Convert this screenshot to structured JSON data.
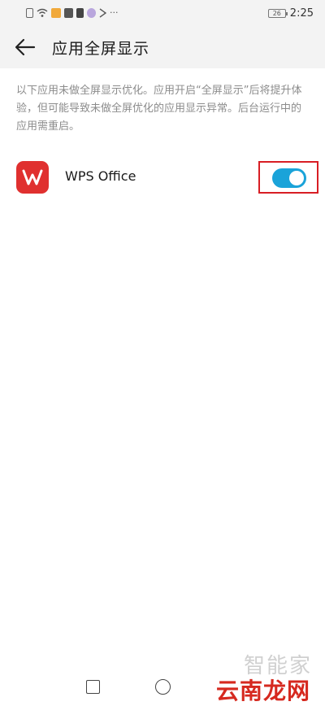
{
  "status_bar": {
    "time": "2:25",
    "battery_level": "26",
    "more_indicator": "···"
  },
  "header": {
    "title": "应用全屏显示"
  },
  "description": "以下应用未做全屏显示优化。应用开启“全屏显示”后将提升体验，但可能导致未做全屏优化的应用显示异常。后台运行中的应用需重启。",
  "apps": [
    {
      "name": "WPS Office",
      "icon": "wps-office-icon",
      "fullscreen_enabled": true
    }
  ],
  "watermark": {
    "top_text": "智能家",
    "bottom_text": "云南龙网"
  },
  "colors": {
    "toggle_on": "#1aa3d9",
    "highlight_border": "#d81e24",
    "wps_red": "#e0302f",
    "watermark_red": "#d6291f"
  }
}
